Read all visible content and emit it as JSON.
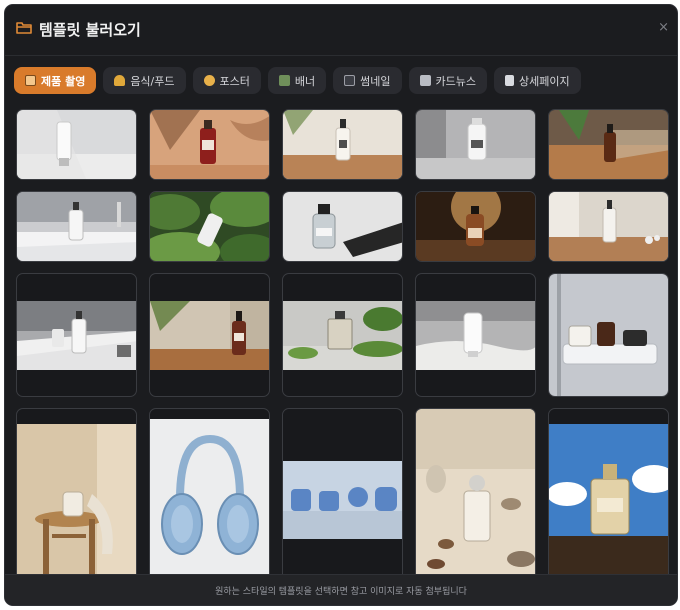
{
  "modal": {
    "title": "템플릿 불러오기",
    "close_symbol": "×",
    "footer_text": "원하는 스타일의 템플릿을 선택하면 참고 이미지로 자동 첨부됩니다"
  },
  "tabs": [
    {
      "label": "제품 촬영",
      "icon": "photo-icon",
      "active": true
    },
    {
      "label": "음식/푸드",
      "icon": "food-icon",
      "active": false
    },
    {
      "label": "포스터",
      "icon": "palette-icon",
      "active": false
    },
    {
      "label": "배너",
      "icon": "banner-icon",
      "active": false
    },
    {
      "label": "썸네일",
      "icon": "thumbnail-icon",
      "active": false
    },
    {
      "label": "카드뉴스",
      "icon": "card-news-icon",
      "active": false
    },
    {
      "label": "상세페이지",
      "icon": "page-icon",
      "active": false
    }
  ],
  "colors": {
    "accent": "#d97b2b",
    "background": "#1b1c1f",
    "tab_background": "#2a2b30"
  },
  "templates": [
    {
      "name": "white-tube-on-white"
    },
    {
      "name": "serum-bottle-peach-shadow"
    },
    {
      "name": "pump-bottle-wood-table"
    },
    {
      "name": "white-bottle-grey-backdrop"
    },
    {
      "name": "amber-bottle-window-leaves"
    },
    {
      "name": "bottle-bathroom-sink"
    },
    {
      "name": "white-bottle-monstera-leaves"
    },
    {
      "name": "glass-bottle-hard-shadow"
    },
    {
      "name": "amber-bottle-sunset-glow"
    },
    {
      "name": "pump-bottle-windowsill"
    },
    {
      "name": "bottles-counter-shadow"
    },
    {
      "name": "amber-pump-leaf-shadow"
    },
    {
      "name": "perfume-with-plant"
    },
    {
      "name": "white-tube-sand"
    },
    {
      "name": "jars-on-shower-shelf"
    },
    {
      "name": "mug-on-wooden-stool"
    },
    {
      "name": "blue-headphones"
    },
    {
      "name": "blue-devices-row"
    },
    {
      "name": "serum-with-pebbles"
    },
    {
      "name": "perfume-blue-sky"
    }
  ]
}
